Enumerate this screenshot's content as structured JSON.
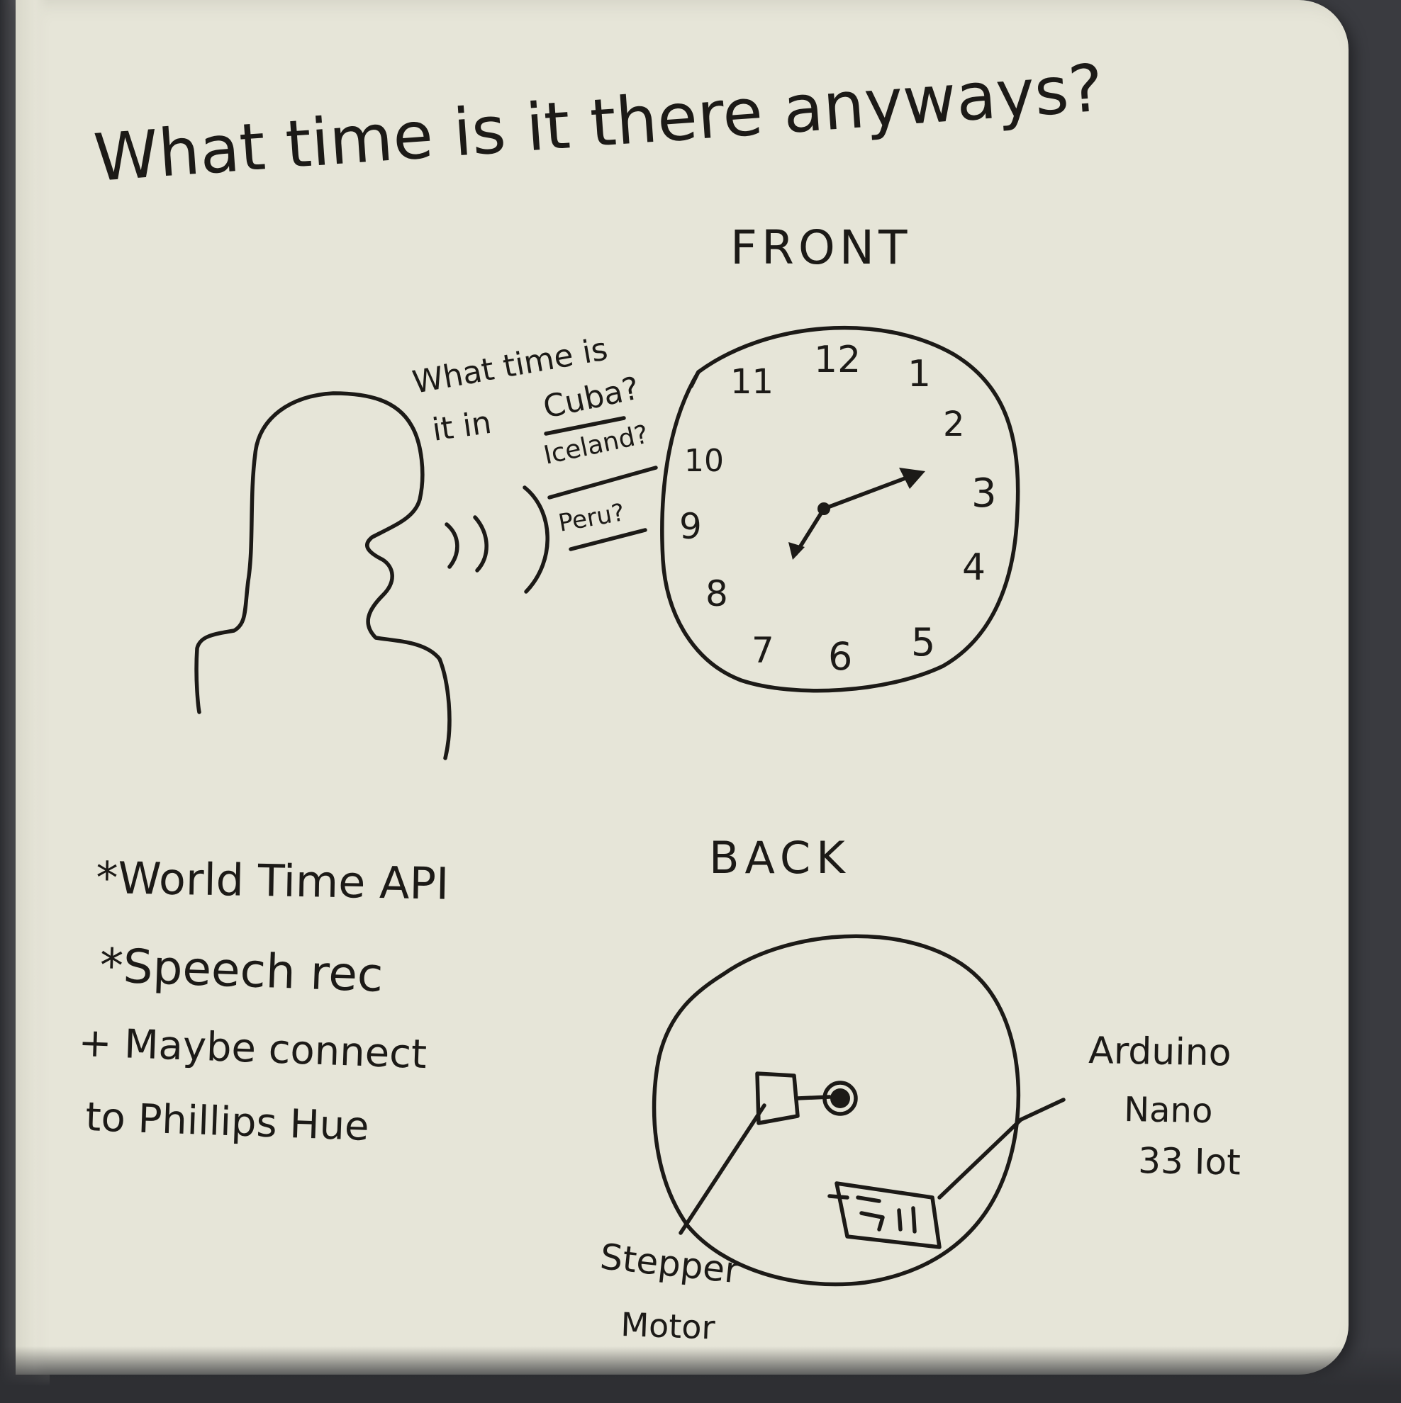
{
  "title": "What time is it there anyways?",
  "labels": {
    "front": "FRONT",
    "back": "BACK"
  },
  "speech": {
    "line1": "What time is",
    "line2": "it in",
    "places": [
      "Cuba?",
      "Iceland?",
      "Peru?"
    ]
  },
  "clock_numbers": [
    "12",
    "1",
    "2",
    "3",
    "4",
    "5",
    "6",
    "7",
    "8",
    "9",
    "10",
    "11"
  ],
  "notes": [
    "*World Time API",
    "*Speech rec",
    "+ Maybe connect",
    "to Phillips Hue"
  ],
  "back_labels": {
    "arduino": [
      "Arduino",
      "Nano",
      "33 Iot"
    ],
    "stepper": [
      "Stepper",
      "Motor"
    ]
  },
  "colors": {
    "paper": "#e6e5d8",
    "ink": "#1c1a17",
    "background": "#3a3b40"
  }
}
